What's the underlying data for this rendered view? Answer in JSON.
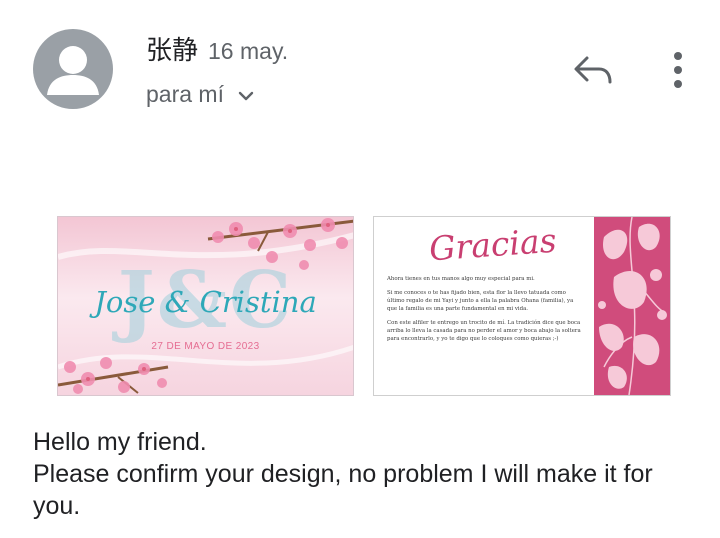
{
  "header": {
    "avatar_icon": "person-avatar-icon",
    "sender_name": "张静",
    "date": "16 may.",
    "recipient_label": "para mí",
    "expand_icon": "chevron-down-icon",
    "reply_icon": "reply-icon",
    "more_icon": "more-vert-icon"
  },
  "attachments": {
    "left": {
      "initials": "J&C",
      "names": "Jose & Cristina",
      "date": "27 DE MAYO DE 2023"
    },
    "right": {
      "heading": "Gracias",
      "paragraphs": [
        "Ahora tienes en tus manos algo muy especial para mi.",
        "Si me conoces o te has fijado bien, esta flor la llevo tatuada como último regalo de mi Yayi y junto a ella la palabra Ohana (familia), ya que la familia es una parte fundamental en mi vida.",
        "Con este alfiler te entrego un trocito de mí. La tradición dice que boca arriba lo lleva la casada para no perder el amor y boca abajo la soltera para encontrarlo, y yo te digo que lo coloques como quieras ;-)"
      ]
    }
  },
  "body": {
    "lines": [
      "Hello my friend.",
      "Please confirm your design, no problem I will make it for you."
    ]
  },
  "colors": {
    "accent_pink": "#c93f71",
    "teal": "#2ea8b8",
    "secondary_text": "#5f6368"
  }
}
